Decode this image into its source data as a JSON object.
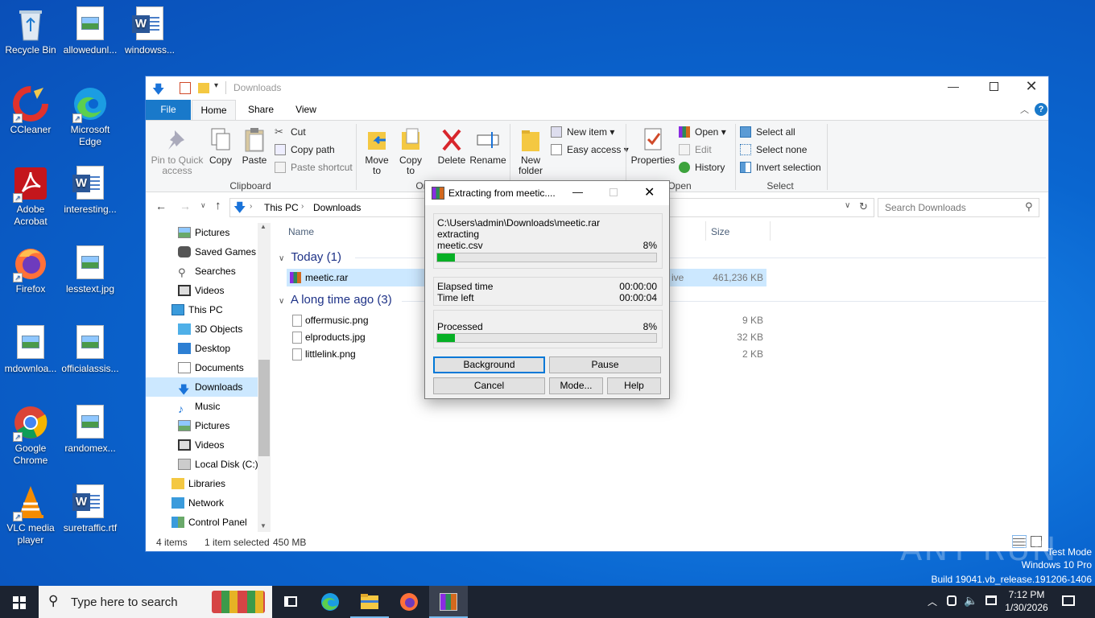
{
  "desktop": {
    "icons": [
      {
        "label": "Recycle Bin"
      },
      {
        "label": "allowedunl..."
      },
      {
        "label": "windowss..."
      },
      {
        "label": "CCleaner"
      },
      {
        "label": "Microsoft Edge"
      },
      {
        "label": "Adobe Acrobat"
      },
      {
        "label": "interesting..."
      },
      {
        "label": "Firefox"
      },
      {
        "label": "lesstext.jpg"
      },
      {
        "label": "mdownloa..."
      },
      {
        "label": "officialassis..."
      },
      {
        "label": "Google Chrome"
      },
      {
        "label": "randomex..."
      },
      {
        "label": "VLC media player"
      },
      {
        "label": "suretraffic.rtf"
      }
    ],
    "watermark": {
      "line1": "Test Mode",
      "line2": "Windows 10 Pro",
      "line3": "Build 19041.vb_release.191206-1406",
      "brand": "ANY RUN"
    }
  },
  "explorer": {
    "title": "Downloads",
    "tabs": {
      "file": "File",
      "home": "Home",
      "share": "Share",
      "view": "View"
    },
    "ribbon": {
      "pin": "Pin to Quick access",
      "copy": "Copy",
      "paste": "Paste",
      "cut": "Cut",
      "copy_path": "Copy path",
      "paste_shortcut": "Paste shortcut",
      "clipboard": "Clipboard",
      "move_to": "Move to",
      "copy_to": "Copy to",
      "organize": "Or",
      "delete": "Delete",
      "rename": "Rename",
      "new_folder": "New folder",
      "new_item": "New item",
      "easy_access": "Easy access",
      "properties": "Properties",
      "open": "Open",
      "edit": "Edit",
      "history": "History",
      "open_group": "Open",
      "select_all": "Select all",
      "select_none": "Select none",
      "invert": "Invert selection",
      "select_group": "Select"
    },
    "address": {
      "root": "This PC",
      "folder": "Downloads"
    },
    "search_placeholder": "Search Downloads",
    "nav": [
      {
        "label": "Pictures"
      },
      {
        "label": "Saved Games"
      },
      {
        "label": "Searches"
      },
      {
        "label": "Videos"
      },
      {
        "label": "This PC"
      },
      {
        "label": "3D Objects"
      },
      {
        "label": "Desktop"
      },
      {
        "label": "Documents"
      },
      {
        "label": "Downloads"
      },
      {
        "label": "Music"
      },
      {
        "label": "Pictures"
      },
      {
        "label": "Videos"
      },
      {
        "label": "Local Disk (C:)"
      },
      {
        "label": "Libraries"
      },
      {
        "label": "Network"
      },
      {
        "label": "Control Panel"
      }
    ],
    "columns": {
      "name": "Name",
      "size": "Size"
    },
    "groups": {
      "today": "Today (1)",
      "older": "A long time ago (3)"
    },
    "files": [
      {
        "name": "meetic.rar",
        "type_partial": "ive",
        "size": "461,236 KB"
      },
      {
        "name": "offermusic.png",
        "size": "9 KB"
      },
      {
        "name": "elproducts.jpg",
        "size": "32 KB"
      },
      {
        "name": "littlelink.png",
        "size": "2 KB"
      }
    ],
    "status": {
      "items": "4 items",
      "selected": "1 item selected",
      "size": "450 MB"
    }
  },
  "rar": {
    "title": "Extracting from meetic....",
    "path": "C:\\Users\\admin\\Downloads\\meetic.rar",
    "action": "extracting",
    "file": "meetic.csv",
    "file_pct": "8%",
    "file_progress": 0.08,
    "elapsed_label": "Elapsed time",
    "elapsed": "00:00:00",
    "left_label": "Time left",
    "left": "00:00:04",
    "processed_label": "Processed",
    "processed_pct": "8%",
    "processed_progress": 0.08,
    "buttons": {
      "background": "Background",
      "pause": "Pause",
      "cancel": "Cancel",
      "mode": "Mode...",
      "help": "Help"
    }
  },
  "taskbar": {
    "search_placeholder": "Type here to search",
    "time": "7:12 PM",
    "date": "1/30/2026"
  }
}
